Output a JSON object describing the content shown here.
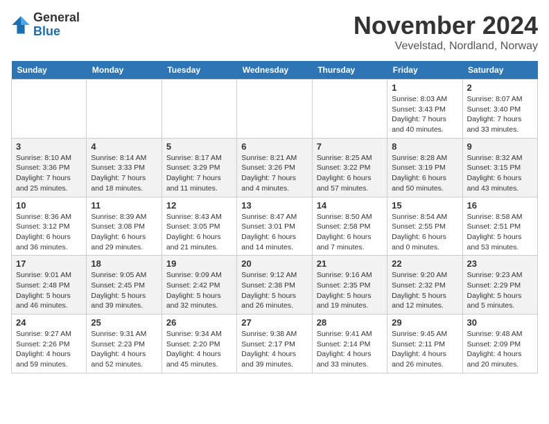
{
  "logo": {
    "general": "General",
    "blue": "Blue"
  },
  "title": "November 2024",
  "subtitle": "Vevelstad, Nordland, Norway",
  "headers": [
    "Sunday",
    "Monday",
    "Tuesday",
    "Wednesday",
    "Thursday",
    "Friday",
    "Saturday"
  ],
  "weeks": [
    [
      {
        "day": "",
        "info": ""
      },
      {
        "day": "",
        "info": ""
      },
      {
        "day": "",
        "info": ""
      },
      {
        "day": "",
        "info": ""
      },
      {
        "day": "",
        "info": ""
      },
      {
        "day": "1",
        "info": "Sunrise: 8:03 AM\nSunset: 3:43 PM\nDaylight: 7 hours\nand 40 minutes."
      },
      {
        "day": "2",
        "info": "Sunrise: 8:07 AM\nSunset: 3:40 PM\nDaylight: 7 hours\nand 33 minutes."
      }
    ],
    [
      {
        "day": "3",
        "info": "Sunrise: 8:10 AM\nSunset: 3:36 PM\nDaylight: 7 hours\nand 25 minutes."
      },
      {
        "day": "4",
        "info": "Sunrise: 8:14 AM\nSunset: 3:33 PM\nDaylight: 7 hours\nand 18 minutes."
      },
      {
        "day": "5",
        "info": "Sunrise: 8:17 AM\nSunset: 3:29 PM\nDaylight: 7 hours\nand 11 minutes."
      },
      {
        "day": "6",
        "info": "Sunrise: 8:21 AM\nSunset: 3:26 PM\nDaylight: 7 hours\nand 4 minutes."
      },
      {
        "day": "7",
        "info": "Sunrise: 8:25 AM\nSunset: 3:22 PM\nDaylight: 6 hours\nand 57 minutes."
      },
      {
        "day": "8",
        "info": "Sunrise: 8:28 AM\nSunset: 3:19 PM\nDaylight: 6 hours\nand 50 minutes."
      },
      {
        "day": "9",
        "info": "Sunrise: 8:32 AM\nSunset: 3:15 PM\nDaylight: 6 hours\nand 43 minutes."
      }
    ],
    [
      {
        "day": "10",
        "info": "Sunrise: 8:36 AM\nSunset: 3:12 PM\nDaylight: 6 hours\nand 36 minutes."
      },
      {
        "day": "11",
        "info": "Sunrise: 8:39 AM\nSunset: 3:08 PM\nDaylight: 6 hours\nand 29 minutes."
      },
      {
        "day": "12",
        "info": "Sunrise: 8:43 AM\nSunset: 3:05 PM\nDaylight: 6 hours\nand 21 minutes."
      },
      {
        "day": "13",
        "info": "Sunrise: 8:47 AM\nSunset: 3:01 PM\nDaylight: 6 hours\nand 14 minutes."
      },
      {
        "day": "14",
        "info": "Sunrise: 8:50 AM\nSunset: 2:58 PM\nDaylight: 6 hours\nand 7 minutes."
      },
      {
        "day": "15",
        "info": "Sunrise: 8:54 AM\nSunset: 2:55 PM\nDaylight: 6 hours\nand 0 minutes."
      },
      {
        "day": "16",
        "info": "Sunrise: 8:58 AM\nSunset: 2:51 PM\nDaylight: 5 hours\nand 53 minutes."
      }
    ],
    [
      {
        "day": "17",
        "info": "Sunrise: 9:01 AM\nSunset: 2:48 PM\nDaylight: 5 hours\nand 46 minutes."
      },
      {
        "day": "18",
        "info": "Sunrise: 9:05 AM\nSunset: 2:45 PM\nDaylight: 5 hours\nand 39 minutes."
      },
      {
        "day": "19",
        "info": "Sunrise: 9:09 AM\nSunset: 2:42 PM\nDaylight: 5 hours\nand 32 minutes."
      },
      {
        "day": "20",
        "info": "Sunrise: 9:12 AM\nSunset: 2:38 PM\nDaylight: 5 hours\nand 26 minutes."
      },
      {
        "day": "21",
        "info": "Sunrise: 9:16 AM\nSunset: 2:35 PM\nDaylight: 5 hours\nand 19 minutes."
      },
      {
        "day": "22",
        "info": "Sunrise: 9:20 AM\nSunset: 2:32 PM\nDaylight: 5 hours\nand 12 minutes."
      },
      {
        "day": "23",
        "info": "Sunrise: 9:23 AM\nSunset: 2:29 PM\nDaylight: 5 hours\nand 5 minutes."
      }
    ],
    [
      {
        "day": "24",
        "info": "Sunrise: 9:27 AM\nSunset: 2:26 PM\nDaylight: 4 hours\nand 59 minutes."
      },
      {
        "day": "25",
        "info": "Sunrise: 9:31 AM\nSunset: 2:23 PM\nDaylight: 4 hours\nand 52 minutes."
      },
      {
        "day": "26",
        "info": "Sunrise: 9:34 AM\nSunset: 2:20 PM\nDaylight: 4 hours\nand 45 minutes."
      },
      {
        "day": "27",
        "info": "Sunrise: 9:38 AM\nSunset: 2:17 PM\nDaylight: 4 hours\nand 39 minutes."
      },
      {
        "day": "28",
        "info": "Sunrise: 9:41 AM\nSunset: 2:14 PM\nDaylight: 4 hours\nand 33 minutes."
      },
      {
        "day": "29",
        "info": "Sunrise: 9:45 AM\nSunset: 2:11 PM\nDaylight: 4 hours\nand 26 minutes."
      },
      {
        "day": "30",
        "info": "Sunrise: 9:48 AM\nSunset: 2:09 PM\nDaylight: 4 hours\nand 20 minutes."
      }
    ]
  ]
}
